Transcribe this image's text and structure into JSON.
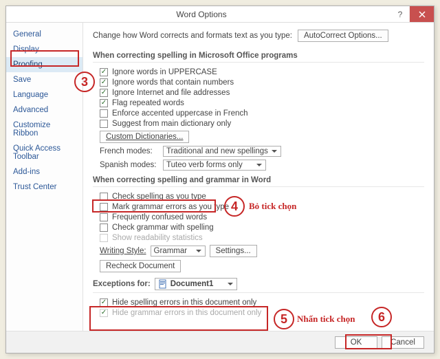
{
  "window": {
    "title": "Word Options"
  },
  "sidebar": {
    "items": [
      {
        "label": "General"
      },
      {
        "label": "Display"
      },
      {
        "label": "Proofing"
      },
      {
        "label": "Save"
      },
      {
        "label": "Language"
      },
      {
        "label": "Advanced"
      },
      {
        "label": "Customize Ribbon"
      },
      {
        "label": "Quick Access Toolbar"
      },
      {
        "label": "Add-ins"
      },
      {
        "label": "Trust Center"
      }
    ]
  },
  "content": {
    "autoCorrect": {
      "intro": "Change how Word corrects and formats text as you type:",
      "button": "AutoCorrect Options..."
    },
    "section1": {
      "title": "When correcting spelling in Microsoft Office programs",
      "opts": [
        {
          "label": "Ignore words in UPPERCASE",
          "checked": true
        },
        {
          "label": "Ignore words that contain numbers",
          "checked": true
        },
        {
          "label": "Ignore Internet and file addresses",
          "checked": true
        },
        {
          "label": "Flag repeated words",
          "checked": true
        },
        {
          "label": "Enforce accented uppercase in French",
          "checked": false
        },
        {
          "label": "Suggest from main dictionary only",
          "checked": false
        }
      ],
      "customDict": "Custom Dictionaries...",
      "french": {
        "label": "French modes:",
        "value": "Traditional and new spellings"
      },
      "spanish": {
        "label": "Spanish modes:",
        "value": "Tuteo verb forms only"
      }
    },
    "section2": {
      "title": "When correcting spelling and grammar in Word",
      "opts": [
        {
          "label": "Check spelling as you type",
          "checked": false
        },
        {
          "label": "Mark grammar errors as you type",
          "checked": false
        },
        {
          "label": "Frequently confused words",
          "checked": false
        },
        {
          "label": "Check grammar with spelling",
          "checked": false
        },
        {
          "label": "Show readability statistics",
          "checked": false,
          "disabled": true
        }
      ],
      "writingStyle": {
        "label": "Writing Style:",
        "value": "Grammar",
        "settings": "Settings..."
      },
      "recheck": "Recheck Document"
    },
    "section3": {
      "title": "Exceptions for:",
      "doc": "Document1",
      "opts": [
        {
          "label": "Hide spelling errors in this document only",
          "checked": true
        },
        {
          "label": "Hide grammar errors in this document only",
          "checked": true,
          "disabled": true
        }
      ]
    }
  },
  "footer": {
    "ok": "OK",
    "cancel": "Cancel"
  },
  "annotations": {
    "n3": "3",
    "n4": "4",
    "n5": "5",
    "n6": "6",
    "t4": "Bỏ tick chọn",
    "t5": "Nhấn tick chọn"
  }
}
